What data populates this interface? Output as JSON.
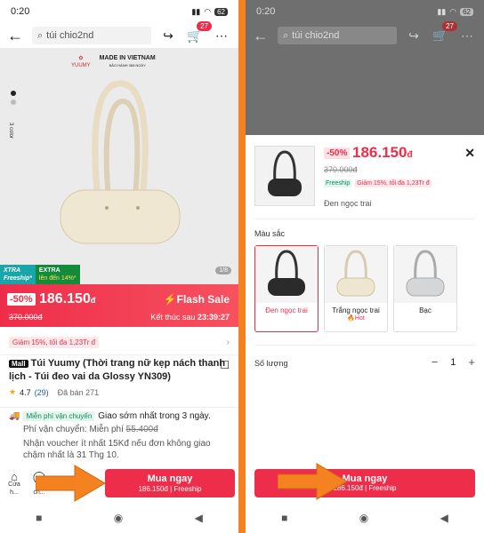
{
  "left": {
    "status": {
      "time": "0:20",
      "battery": "62"
    },
    "search": {
      "placeholder": "túi chio2nd"
    },
    "cart_count": "27",
    "hero": {
      "brand_logo": "YUUMY",
      "made_in": "MADE IN VIETNAM",
      "warranty": "BẢO HÀNH 365 NGÀY",
      "color_count": "3 color",
      "xtra_label": "XTRA",
      "xtra_sub": "Freeship*",
      "extra_label": "EXTRA",
      "extra_sub": "lên đến 14%*",
      "pager": "1/8"
    },
    "flash": {
      "discount": "-50%",
      "price": "186.150",
      "currency": "đ",
      "old_price": "370.000đ",
      "title": "Flash Sale",
      "ends_label": "Kết thúc sau",
      "countdown": "23:39:27"
    },
    "voucher": "Giảm 15%, tối đa 1,23Tr đ",
    "product": {
      "mall": "Mall",
      "title": "Túi Yuumy (Thời trang nữ kẹp nách thanh lịch - Túi đeo vai da Glossy YN309)",
      "rating": "4.7",
      "reviews": "(29)",
      "sold": "Đã bán 271"
    },
    "shipping": {
      "free_tag": "Miễn phí vận chuyển",
      "text": "Giao sớm nhất trong 3 ngày.",
      "fee_label": "Phí vận chuyển: Miễn phí",
      "fee_old": "55.400đ",
      "note": "Nhận voucher ít nhất 15Kđ nếu đơn không giao chậm nhất là 31 Thg 10."
    },
    "bottom": {
      "shop_label": "Cửa h...",
      "chat_label": "Trò ch...",
      "buy_label": "Mua ngay",
      "buy_sub": "186.150đ | Freeship"
    }
  },
  "right": {
    "status": {
      "time": "0:20",
      "battery": "62"
    },
    "search": {
      "placeholder": "túi chio2nd"
    },
    "cart_count": "27",
    "sheet": {
      "discount": "-50%",
      "price": "186.150",
      "currency": "đ",
      "old_price": "370.000đ",
      "freeship": "Freeship",
      "voucher": "Giảm 15%, tối đa 1,23Tr đ",
      "variant": "Đen ngọc trai",
      "color_label": "Màu sắc",
      "options": [
        {
          "name": "Đen ngọc trai",
          "hot": ""
        },
        {
          "name": "Trắng ngọc trai",
          "hot": "Hot"
        },
        {
          "name": "Bạc",
          "hot": ""
        }
      ],
      "qty_label": "Số lượng",
      "qty_value": "1",
      "buy_label": "Mua ngay",
      "buy_sub": "186.150đ | Freeship"
    }
  },
  "colors": {
    "accent": "#ee2d4a",
    "divider": "#f58220",
    "arrow": "#f58220"
  }
}
